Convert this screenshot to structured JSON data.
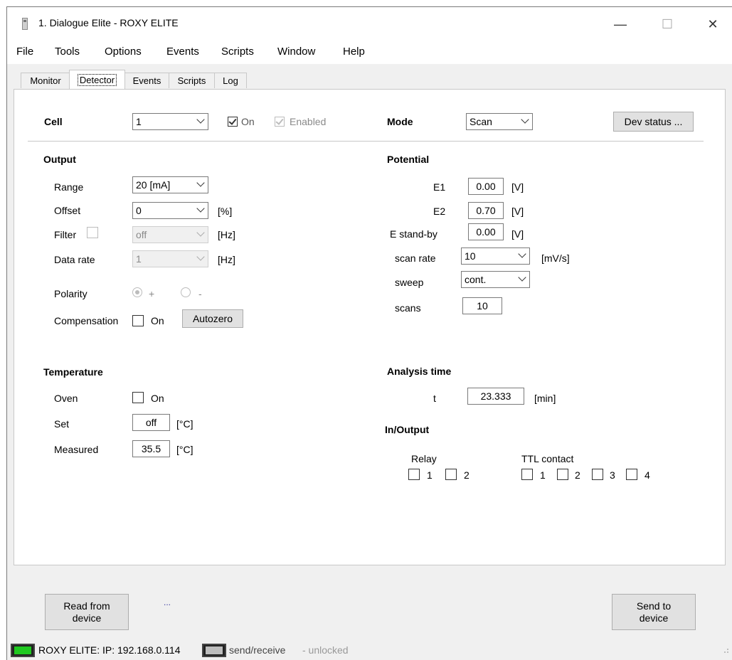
{
  "window": {
    "title": "1. Dialogue Elite - ROXY ELITE",
    "minimize": "—",
    "maximize": "☐",
    "close": "✕"
  },
  "menu": [
    "File",
    "Tools",
    "Options",
    "Events",
    "Scripts",
    "Window",
    "Help"
  ],
  "tabs": [
    {
      "label": "Monitor",
      "active": false
    },
    {
      "label": "Detector",
      "active": true
    },
    {
      "label": "Events",
      "active": false
    },
    {
      "label": "Scripts",
      "active": false
    },
    {
      "label": "Log",
      "active": false
    }
  ],
  "header": {
    "cell_label": "Cell",
    "cell_value": "1",
    "on_label": "On",
    "on_checked": true,
    "enabled_label": "Enabled",
    "enabled_checked": true,
    "mode_label": "Mode",
    "mode_value": "Scan",
    "dev_status_button": "Dev status ..."
  },
  "output": {
    "section_title": "Output",
    "range_label": "Range",
    "range_value": "20 [mA]",
    "offset_label": "Offset",
    "offset_value": "0",
    "offset_unit": "[%]",
    "filter_label": "Filter",
    "filter_value": "off",
    "filter_unit": "[Hz]",
    "data_rate_label": "Data rate",
    "data_rate_value": "1",
    "data_rate_unit": "[Hz]",
    "polarity_label": "Polarity",
    "polarity_plus": "+",
    "polarity_minus": "-",
    "compensation_label": "Compensation",
    "compensation_on_label": "On",
    "autozero_button": "Autozero"
  },
  "potential": {
    "section_title": "Potential",
    "e1_label": "E1",
    "e1_value": "0.00",
    "e1_unit": "[V]",
    "e2_label": "E2",
    "e2_value": "0.70",
    "e2_unit": "[V]",
    "estandby_label": "E stand-by",
    "estandby_value": "0.00",
    "estandby_unit": "[V]",
    "scan_rate_label": "scan rate",
    "scan_rate_value": "10",
    "scan_rate_unit": "[mV/s]",
    "sweep_label": "sweep",
    "sweep_value": "cont.",
    "scans_label": "scans",
    "scans_value": "10"
  },
  "temperature": {
    "section_title": "Temperature",
    "oven_label": "Oven",
    "oven_on_label": "On",
    "set_label": "Set",
    "set_value": "off",
    "set_unit": "[°C]",
    "measured_label": "Measured",
    "measured_value": "35.5",
    "measured_unit": "[°C]"
  },
  "analysis": {
    "section_title": "Analysis time",
    "t_label": "t",
    "t_value": "23.333",
    "t_unit": "[min]"
  },
  "inout": {
    "section_title": "In/Output",
    "relay_label": "Relay",
    "relay_items": [
      "1",
      "2"
    ],
    "ttl_label": "TTL contact",
    "ttl_items": [
      "1",
      "2",
      "3",
      "4"
    ]
  },
  "bottom": {
    "read_button": "Read from device",
    "ellipsis": "...",
    "send_button": "Send to device"
  },
  "status": {
    "device_text": "ROXY ELITE:  IP: 192.168.0.114",
    "send_receive": "send/receive",
    "lock_state": "- unlocked",
    "connected_color": "#1fc820"
  }
}
